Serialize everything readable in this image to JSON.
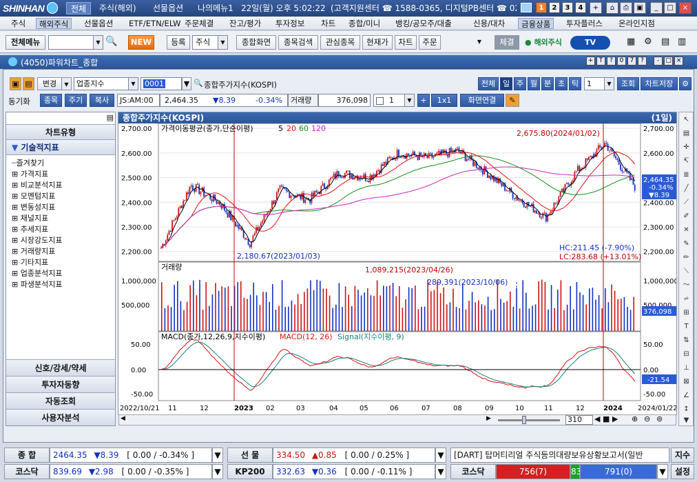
{
  "titlebar": {
    "logo": "SHINHAN",
    "menus": [
      "전체",
      "주식(해외)",
      "선물옵션",
      "나의메뉴1"
    ],
    "clock": "22일(월) 오후 5:02:22",
    "contact": "(고객지원센터 ☎ 1588-0365, 디지털PB센터 ☎ 02",
    "pages": [
      "1",
      "2",
      "3",
      "4"
    ]
  },
  "menubar": {
    "items": [
      "주식",
      "해외주식",
      "선물옵션",
      "ETF/ETN/ELW",
      "주문체결",
      "잔고/평가",
      "투자정보",
      "차트",
      "종합/미니",
      "뱅킹/공모주/대출",
      "신용/대차",
      "금융상품",
      "투자플러스",
      "온라인지점"
    ],
    "selected": "해외주식"
  },
  "toolbar": {
    "all_menu": "전체메뉴",
    "new_label": "NEW",
    "register": "등록",
    "type": "주식",
    "buttons": [
      "종합화면",
      "종목검색",
      "관심종목",
      "현재가",
      "차트",
      "주문"
    ],
    "conclusion": "체결",
    "overseas": "해외주식",
    "tv": "TV"
  },
  "window": {
    "title": "(4050)파워차트_종합",
    "controls": [
      "+",
      "T",
      "?",
      "0",
      "7",
      "?",
      "-",
      "□",
      "×"
    ]
  },
  "chart_toolbar": {
    "change": "변경",
    "category": "업종지수",
    "code": "0001",
    "name": "종합주가지수(KOSPI)",
    "periods": [
      "전체",
      "일",
      "주",
      "월",
      "분",
      "초",
      "틱"
    ],
    "period_count": "1",
    "lookup": "조회",
    "save": "차트저장"
  },
  "chart_toolbar2": {
    "sync": "동기화",
    "tabs": [
      "종목",
      "주기",
      "복사"
    ],
    "time": "JS:AM:00",
    "price": "2,464.35",
    "change": "▼8.39",
    "rate": "-0.34%",
    "vol_label": "거래량",
    "volume": "376,098",
    "count": "1",
    "layout": "1x1",
    "link": "화면연결"
  },
  "left_panel": {
    "header": "차트유형",
    "section": "기술적지표",
    "items": [
      "즐겨찾기",
      "가격지표",
      "비교분석지표",
      "모멘텀지표",
      "변동성지표",
      "채널지표",
      "추세지표",
      "시장강도지표",
      "거래량지표",
      "기타지표",
      "업종분석지표",
      "파생분석지표"
    ],
    "bottom_buttons": [
      "신호/강세/약세",
      "투자자동향",
      "자동조회",
      "사용자분석"
    ]
  },
  "chart": {
    "header_title": "종합주가지수(KOSPI)",
    "header_period": "(1일)",
    "price_legend_label": "가격이동평균(종가,단순이평)",
    "ma_periods": [
      "5",
      "20",
      "60",
      "120"
    ],
    "ma_colors": [
      "#000000",
      "#e01010",
      "#109010",
      "#d020c0"
    ],
    "price_ticks": [
      "2,700.00",
      "2,600.00",
      "2,500.00",
      "2,400.00",
      "2,300.00",
      "2,200.00"
    ],
    "high_label": "2,675.80(2024/01/02)",
    "low_label": "2,180.67(2023/01/03)",
    "hc": "HC:211.45 (-7.90%)",
    "lc": "LC:283.68 (+13.01%)",
    "last_price": "2,464.35",
    "last_rate": "-0.34%",
    "last_change": "▼8.39",
    "volume_label": "거래량",
    "volume_ticks": [
      "1,000,000",
      "500,000"
    ],
    "vol_high_label": "1,089,215(2023/04/26)",
    "vol_mark_label": "289,391(2023/10/06)",
    "last_volume": "376,098",
    "macd_label": "MACD(종가,12,26,9,지수이평)",
    "macd_legend": "MACD(12, 26)",
    "signal_legend": "Signal(지수이평, 9)",
    "macd_ticks": [
      "50.00",
      "0.00",
      "-50.00"
    ],
    "last_macd": "-21.54",
    "x_labels": [
      "2022/10/21",
      "11",
      "12",
      "2023",
      "02",
      "03",
      "04",
      "05",
      "06",
      "07",
      "08",
      "09",
      "10",
      "11",
      "12",
      "2024",
      "2024/01/22"
    ],
    "scroll_value": "310"
  },
  "chart_data": {
    "type": "line",
    "title": "종합주가지수(KOSPI)",
    "x": [
      "2022/10/21",
      "2022/11",
      "2022/12",
      "2023/01",
      "2023/02",
      "2023/03",
      "2023/04",
      "2023/05",
      "2023/06",
      "2023/07",
      "2023/08",
      "2023/09",
      "2023/10",
      "2023/11",
      "2023/12",
      "2024/01",
      "2024/01/22"
    ],
    "series": [
      {
        "name": "5",
        "values": [
          2215,
          2470,
          2395,
          2235,
          2450,
          2410,
          2520,
          2500,
          2600,
          2580,
          2610,
          2520,
          2420,
          2340,
          2520,
          2640,
          2464
        ]
      },
      {
        "name": "20",
        "values": [
          2250,
          2420,
          2430,
          2290,
          2400,
          2420,
          2500,
          2500,
          2580,
          2600,
          2590,
          2550,
          2460,
          2380,
          2490,
          2600,
          2520
        ]
      }
    ],
    "ylim": [
      2160,
      2720
    ]
  },
  "bottom": {
    "row1": [
      {
        "label": "종  합",
        "value": "2464.35",
        "change": "▼8.39",
        "range": "[ 0.00  / -0.34% ]"
      },
      {
        "label": "선  물",
        "value": "334.50",
        "change": "▲0.85",
        "range": "[ 0.00  / 0.25% ]"
      }
    ],
    "row2": [
      {
        "label": "코스닥",
        "value": "839.69",
        "change": "▼2.98",
        "range": "[ 0.00  / -0.35% ]"
      },
      {
        "label": "KP200",
        "value": "332.63",
        "change": "▼0.36",
        "range": "[ 0.00  / -0.11% ]"
      }
    ],
    "news": "[DART] 탑머티리얼  주식등의대량보유상황보고서(일반",
    "index_btn": "지수",
    "kosdaq_label": "코스닥",
    "kosdaq_down": "756(7)",
    "kosdaq_same": "83",
    "kosdaq_up": "791(0)",
    "settings": "설정"
  }
}
